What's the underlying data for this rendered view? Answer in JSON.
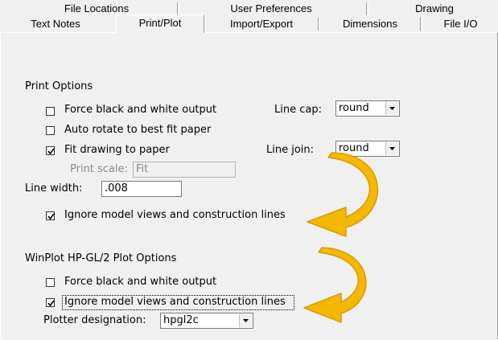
{
  "tabs": {
    "back_row": [
      {
        "label": "File Locations"
      },
      {
        "label": "User Preferences"
      },
      {
        "label": "Drawing"
      }
    ],
    "front_row": [
      {
        "label": "Text Notes"
      },
      {
        "label": "Print/Plot",
        "selected": true
      },
      {
        "label": "Import/Export"
      },
      {
        "label": "Dimensions"
      },
      {
        "label": "File I/O"
      }
    ]
  },
  "print_options": {
    "title": "Print Options",
    "force_bw": {
      "label": "Force black and white output",
      "checked": false
    },
    "auto_rotate": {
      "label": "Auto rotate to best fit paper",
      "checked": false
    },
    "fit_drawing": {
      "label": "Fit drawing to paper",
      "checked": true
    },
    "print_scale": {
      "label": "Print scale:",
      "value": "Fit",
      "disabled": true
    },
    "line_width": {
      "label": "Line width:",
      "value": ".008"
    },
    "ignore_model_views": {
      "label": "Ignore model views and construction lines",
      "checked": true
    },
    "line_cap": {
      "label": "Line cap:",
      "value": "round"
    },
    "line_join": {
      "label": "Line join:",
      "value": "round"
    }
  },
  "winplot_options": {
    "title": "WinPlot HP-GL/2 Plot Options",
    "force_bw": {
      "label": "Force black and white output",
      "checked": false
    },
    "ignore_model_views": {
      "label": "Ignore model views and construction lines",
      "checked": true
    },
    "plotter_designation": {
      "label": "Plotter designation:",
      "value": "hpgl2c"
    }
  },
  "annotation_colors": {
    "arrow_fill": "#f5b800",
    "arrow_stroke": "#e0a000"
  }
}
